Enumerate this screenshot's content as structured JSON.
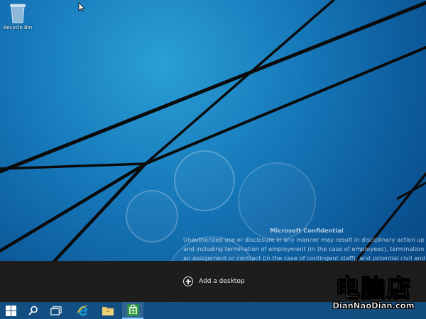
{
  "desktop": {
    "recycle_bin_label": "Recycle Bin"
  },
  "confidential": {
    "title": "Microsoft Confidential",
    "lines": [
      "Unauthorized use or disclosure in any manner may result in disciplinary action up to",
      "and including termination of employment (in the case of employees), termination of",
      "an assignment or contract (in the case of contingent staff), and potential civil and"
    ]
  },
  "task_view": {
    "add_desktop_label": "Add a desktop"
  },
  "taskbar": {
    "items": [
      {
        "name": "start-button",
        "icon": "windows-logo-icon"
      },
      {
        "name": "search-button",
        "icon": "search-icon"
      },
      {
        "name": "task-view-button",
        "icon": "task-view-icon"
      },
      {
        "name": "internet-explorer-button",
        "icon": "internet-explorer-icon"
      },
      {
        "name": "file-explorer-button",
        "icon": "folder-icon"
      },
      {
        "name": "store-button",
        "icon": "store-icon"
      }
    ]
  },
  "watermark": {
    "chinese": "电脑店",
    "site": "DianNaoDian.com"
  },
  "colors": {
    "wallpaper": "#1576b8",
    "task_view_bar": "#1d1d1d",
    "taskbar": "#144e80",
    "store_green": "#2e9e3a",
    "ie_blue": "#1ea1e5",
    "folder_yellow": "#e8c260"
  }
}
